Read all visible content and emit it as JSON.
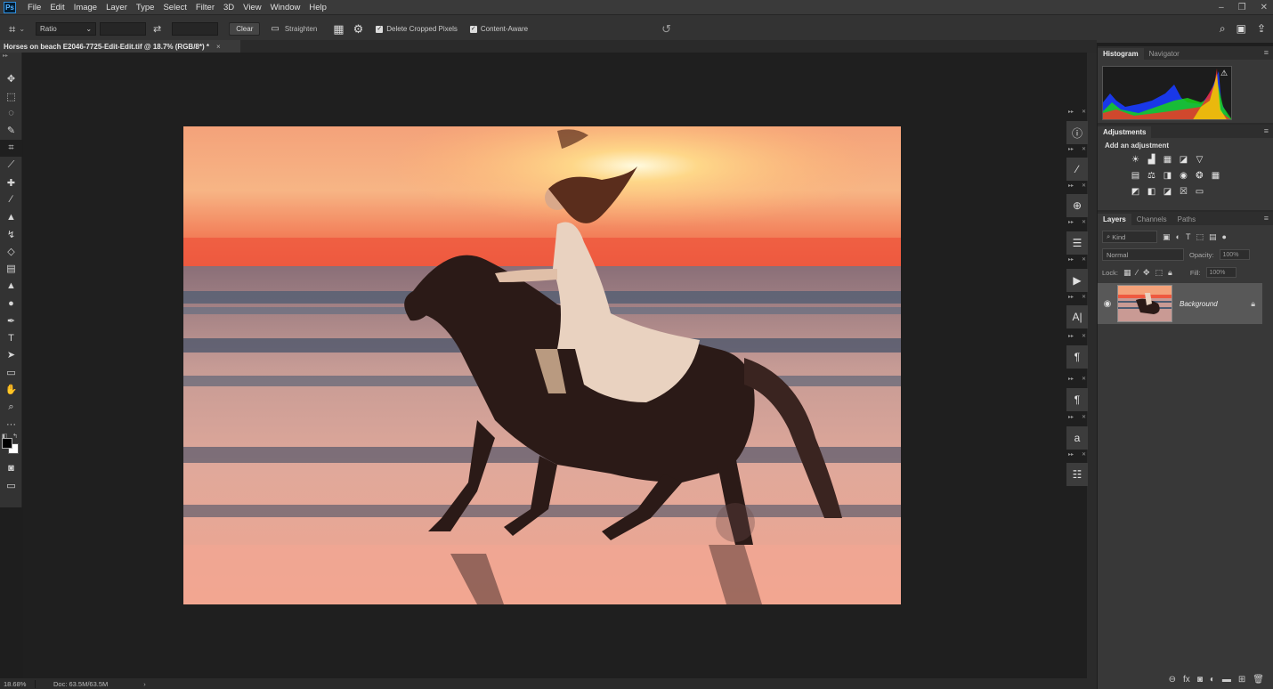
{
  "app": {
    "logo": "Ps",
    "menu": [
      "File",
      "Edit",
      "Image",
      "Layer",
      "Type",
      "Select",
      "Filter",
      "3D",
      "View",
      "Window",
      "Help"
    ],
    "window_controls": {
      "minimize": "–",
      "restore": "❐",
      "close": "✕"
    }
  },
  "options_bar": {
    "ratio_value": "Ratio",
    "clear_label": "Clear",
    "straighten_label": "Straighten",
    "delete_cropped_label": "Delete Cropped Pixels",
    "delete_cropped_checked": true,
    "content_aware_label": "Content-Aware",
    "content_aware_checked": true
  },
  "document": {
    "tab_title": "Horses on beach E2046-7725-Edit-Edit.tif @ 18.7% (RGB/8*) *",
    "zoom": "18.68%",
    "doc_size": "Doc: 63.5M/63.5M"
  },
  "panels": {
    "histogram_tab": "Histogram",
    "navigator_tab": "Navigator",
    "adjustments_tab": "Adjustments",
    "add_adjustment": "Add an adjustment",
    "layers_tab": "Layers",
    "channels_tab": "Channels",
    "paths_tab": "Paths",
    "kind_placeholder": "Kind",
    "blend_mode": "Normal",
    "opacity_label": "Opacity:",
    "opacity_value": "100%",
    "lock_label": "Lock:",
    "fill_label": "Fill:",
    "fill_value": "100%",
    "layer_name": "Background"
  },
  "icons": {
    "tools": [
      "move-icon",
      "marquee-icon",
      "lasso-icon",
      "quick-select-icon",
      "crop-icon",
      "eyedropper-icon",
      "healing-icon",
      "brush-icon",
      "stamp-icon",
      "history-brush-icon",
      "eraser-icon",
      "gradient-icon",
      "blur-icon",
      "dodge-icon",
      "pen-icon",
      "type-icon",
      "path-select-icon",
      "shape-icon",
      "hand-icon",
      "zoom-icon",
      "more-tools-icon"
    ],
    "dock": [
      "info-icon",
      "brush-settings-icon",
      "clone-source-icon",
      "properties-icon",
      "actions-icon",
      "character-icon",
      "paragraph-styles-icon",
      "paragraph-icon",
      "glyphs-icon",
      "character-styles-icon"
    ]
  },
  "colors": {
    "foreground": "#000000",
    "background": "#ffffff",
    "accent": "#2f8fe0"
  }
}
